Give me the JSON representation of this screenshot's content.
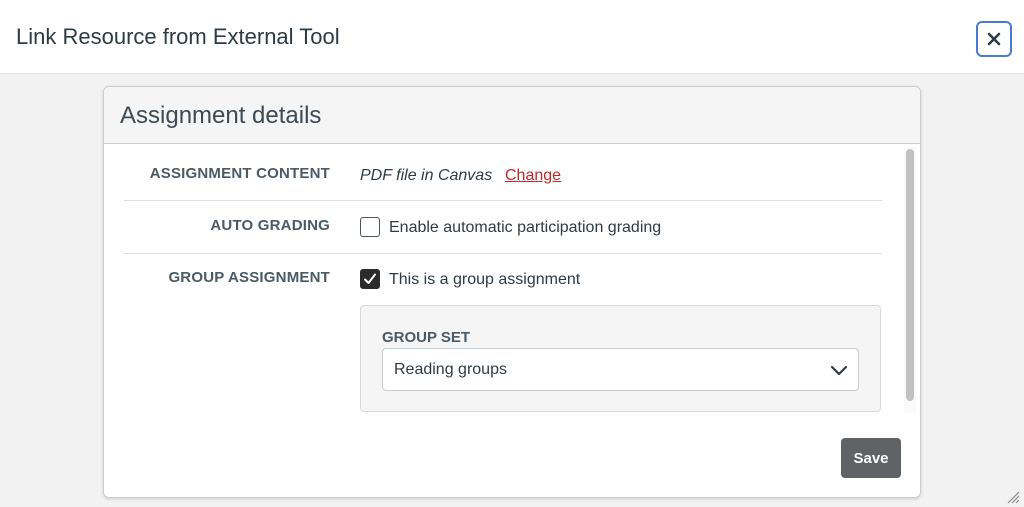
{
  "dialog": {
    "title": "Link Resource from External Tool",
    "close_icon": "close-icon"
  },
  "card": {
    "title": "Assignment details",
    "rows": {
      "assignment_content": {
        "label": "ASSIGNMENT CONTENT",
        "value": "PDF file in Canvas",
        "link_label": "Change"
      },
      "auto_grading": {
        "label": "AUTO GRADING",
        "checkbox_label": "Enable automatic participation grading",
        "checked": false
      },
      "group_assignment": {
        "label": "GROUP ASSIGNMENT",
        "checkbox_label": "This is a group assignment",
        "checked": true,
        "group_set": {
          "label": "GROUP SET",
          "selected": "Reading groups"
        }
      }
    },
    "save_label": "Save"
  },
  "colors": {
    "link": "#c0282b",
    "save_button": "#5f6366",
    "close_border": "#4a7bd0"
  }
}
